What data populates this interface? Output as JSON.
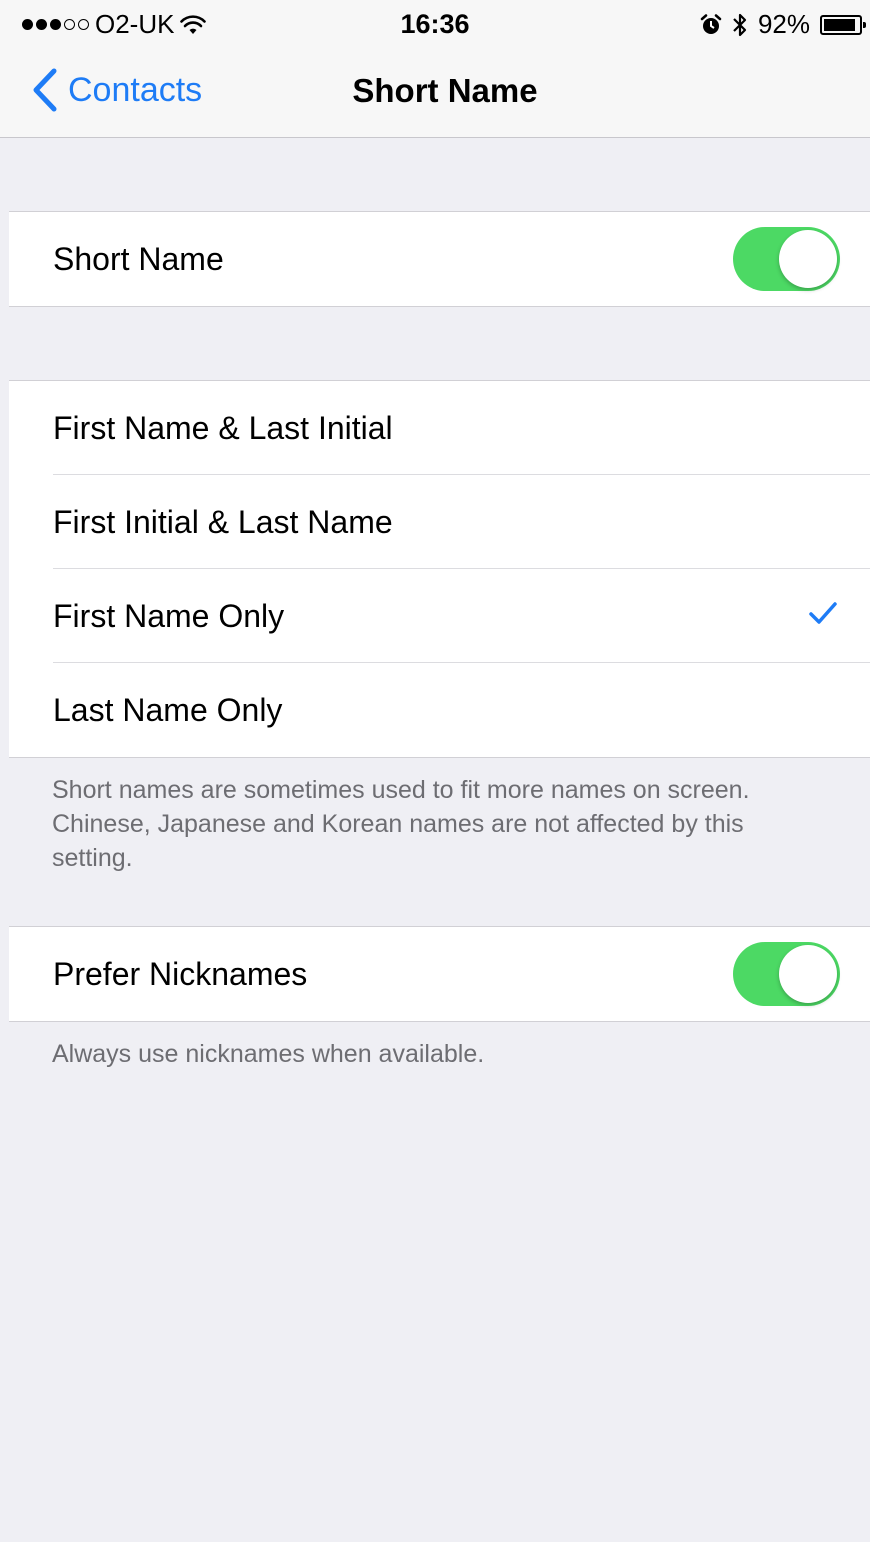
{
  "status_bar": {
    "carrier": "O2-UK",
    "time": "16:36",
    "battery_percent": "92%",
    "battery_level": 0.92,
    "icons": [
      "signal-dots-icon",
      "wifi-icon",
      "alarm-icon",
      "bluetooth-icon",
      "battery-icon"
    ]
  },
  "nav": {
    "back_label": "Contacts",
    "title": "Short Name"
  },
  "short_name_section": {
    "label": "Short Name",
    "enabled": true
  },
  "format_options": {
    "items": [
      {
        "label": "First Name & Last Initial",
        "selected": false
      },
      {
        "label": "First Initial & Last Name",
        "selected": false
      },
      {
        "label": "First Name Only",
        "selected": true
      },
      {
        "label": "Last Name Only",
        "selected": false
      }
    ],
    "footer": "Short names are sometimes used to fit more names on screen. Chinese, Japanese and Korean names are not affected by this setting."
  },
  "nicknames_section": {
    "label": "Prefer Nicknames",
    "enabled": true,
    "footer": "Always use nicknames when available."
  },
  "colors": {
    "accent": "#1e7cf6",
    "toggle_on": "#4cd964",
    "background": "#efeff4"
  }
}
